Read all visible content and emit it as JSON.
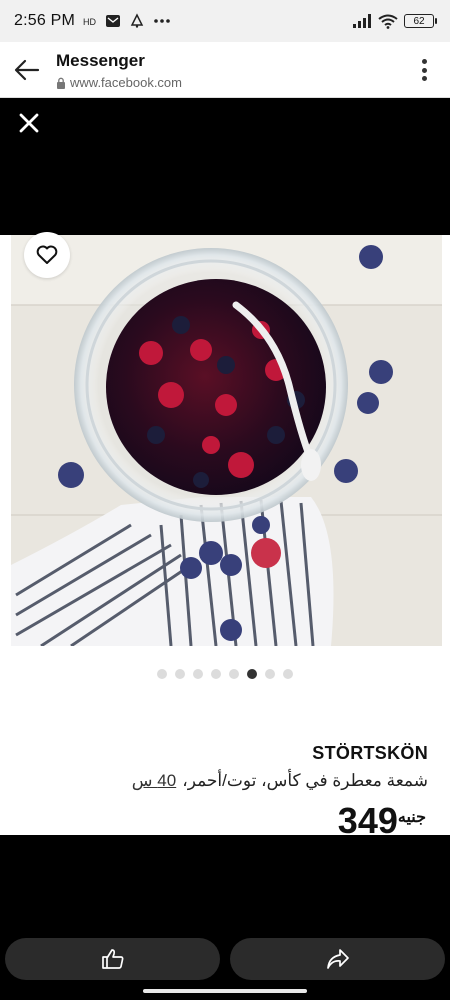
{
  "status_bar": {
    "time": "2:56 PM",
    "battery": "62",
    "icons": [
      "hd-icon",
      "mail-icon",
      "notification-icon",
      "more-dots-icon",
      "signal-icon",
      "wifi-icon",
      "battery-icon"
    ]
  },
  "browser": {
    "title": "Messenger",
    "url": "www.facebook.com"
  },
  "product": {
    "name": "STÖRTSKÖN",
    "description": "شمعة معطرة في كأس، توت/أحمر،",
    "size": "40 س",
    "price": "349",
    "currency": "جنيه",
    "image_count": 8,
    "active_image_index": 5
  },
  "colors": {
    "dark_overlay": "#000000",
    "pill": "#2b2b2b",
    "dot_active": "#333333",
    "dot_inactive": "#dcdcdc"
  },
  "icons": {
    "close": "close-icon",
    "heart": "heart-icon",
    "like": "thumbs-up-icon",
    "share": "share-icon"
  }
}
